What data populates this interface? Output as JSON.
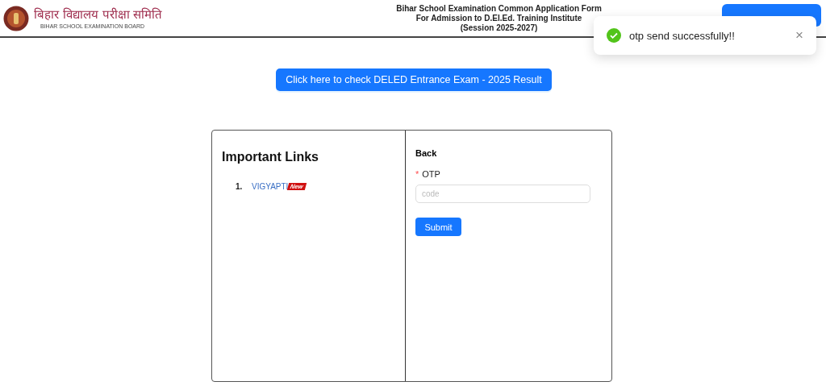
{
  "header": {
    "org_hindi": "बिहार विद्यालय परीक्षा समिति",
    "org_english": "BIHAR SCHOOL EXAMINATION BOARD",
    "title_lines": [
      "Bihar School Examination Common Application Form",
      "For Admission to D.El.Ed. Training Institute",
      "(Session 2025-2027)"
    ]
  },
  "toast": {
    "kind": "success",
    "message": "otp send successfully!!",
    "close": "×"
  },
  "result_button": "Click here to check DELED Entrance Exam - 2025 Result",
  "important_links": {
    "title": "Important Links",
    "items": [
      {
        "number": "1.",
        "label": "VIGYAPTI",
        "badge": "New"
      }
    ]
  },
  "otp_form": {
    "back": "Back",
    "required_mark": "*",
    "label": "OTP",
    "placeholder": "code",
    "submit": "Submit"
  }
}
